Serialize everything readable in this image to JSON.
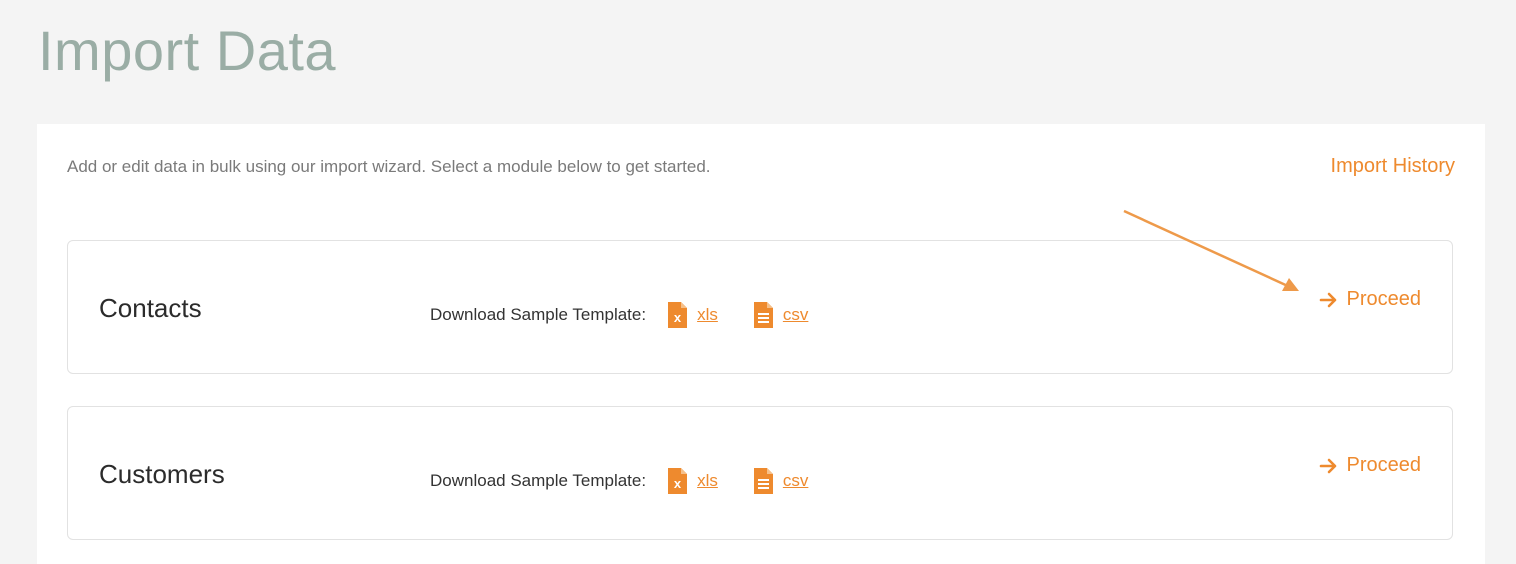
{
  "page": {
    "title": "Import Data"
  },
  "intro": {
    "text": "Add or edit data in bulk using our import wizard. Select a module below to get started.",
    "history_link": "Import History"
  },
  "modules": [
    {
      "name": "Contacts",
      "template_label": "Download Sample Template:",
      "xls_label": "xls",
      "csv_label": "csv",
      "proceed_label": "Proceed"
    },
    {
      "name": "Customers",
      "template_label": "Download Sample Template:",
      "xls_label": "xls",
      "csv_label": "csv",
      "proceed_label": "Proceed"
    }
  ],
  "icons": {
    "xls": "excel-file-icon",
    "csv": "document-file-icon",
    "proceed": "arrow-right-icon"
  },
  "colors": {
    "accent": "#ee8a2e",
    "title": "#9aada5",
    "background": "#f4f4f4",
    "panel": "#ffffff",
    "border": "#e2e2e2"
  }
}
